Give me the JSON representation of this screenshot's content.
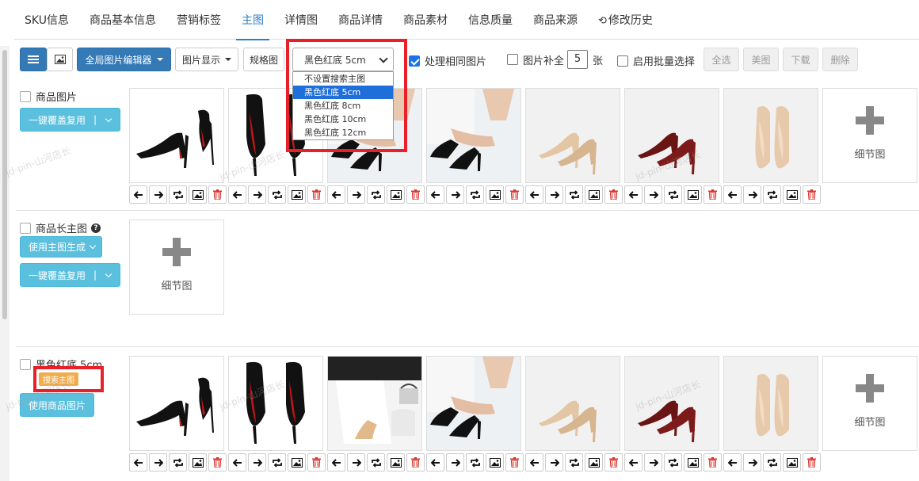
{
  "tabs": [
    {
      "label": "SKU信息",
      "active": false
    },
    {
      "label": "商品基本信息",
      "active": false
    },
    {
      "label": "营销标签",
      "active": false
    },
    {
      "label": "主图",
      "active": true
    },
    {
      "label": "详情图",
      "active": false
    },
    {
      "label": "商品详情",
      "active": false
    },
    {
      "label": "商品素材",
      "active": false
    },
    {
      "label": "信息质量",
      "active": false
    },
    {
      "label": "商品来源",
      "active": false
    },
    {
      "label": "修改历史",
      "active": false
    }
  ],
  "toolbar": {
    "editor_label": "全局图片编辑器",
    "display_label": "图片显示",
    "spec_label": "规格图",
    "select_value": "黑色红底 5cm",
    "same_image_label": "处理相同图片",
    "fill_label": "图片补全",
    "fill_value": "5",
    "fill_unit": "张",
    "batch_label": "启用批量选择",
    "select_all": "全选",
    "beautify": "美图",
    "download": "下载",
    "delete": "删除"
  },
  "dropdown": {
    "options": [
      "不设置搜索主图",
      "黑色红底 5cm",
      "黑色红底 8cm",
      "黑色红底 10cm",
      "黑色红底 12cm"
    ],
    "selected_index": 1
  },
  "sections": {
    "main": {
      "label": "商品图片",
      "cover_button": "一键覆盖复用"
    },
    "long": {
      "label": "商品长主图",
      "gen_button": "使用主图生成",
      "cover_button": "一键覆盖复用"
    },
    "sku": {
      "label": "黑色红底 5cm",
      "badge": "搜索主图",
      "use_button": "使用商品图片"
    }
  },
  "detail_label": "细节图",
  "watermark": "jd-pin-山河店长",
  "colors": {
    "accent": "#2a7fc9",
    "primary": "#337ab7",
    "info": "#5bc0de",
    "highlight": "#e8202a",
    "badge": "#f0ad4e"
  }
}
